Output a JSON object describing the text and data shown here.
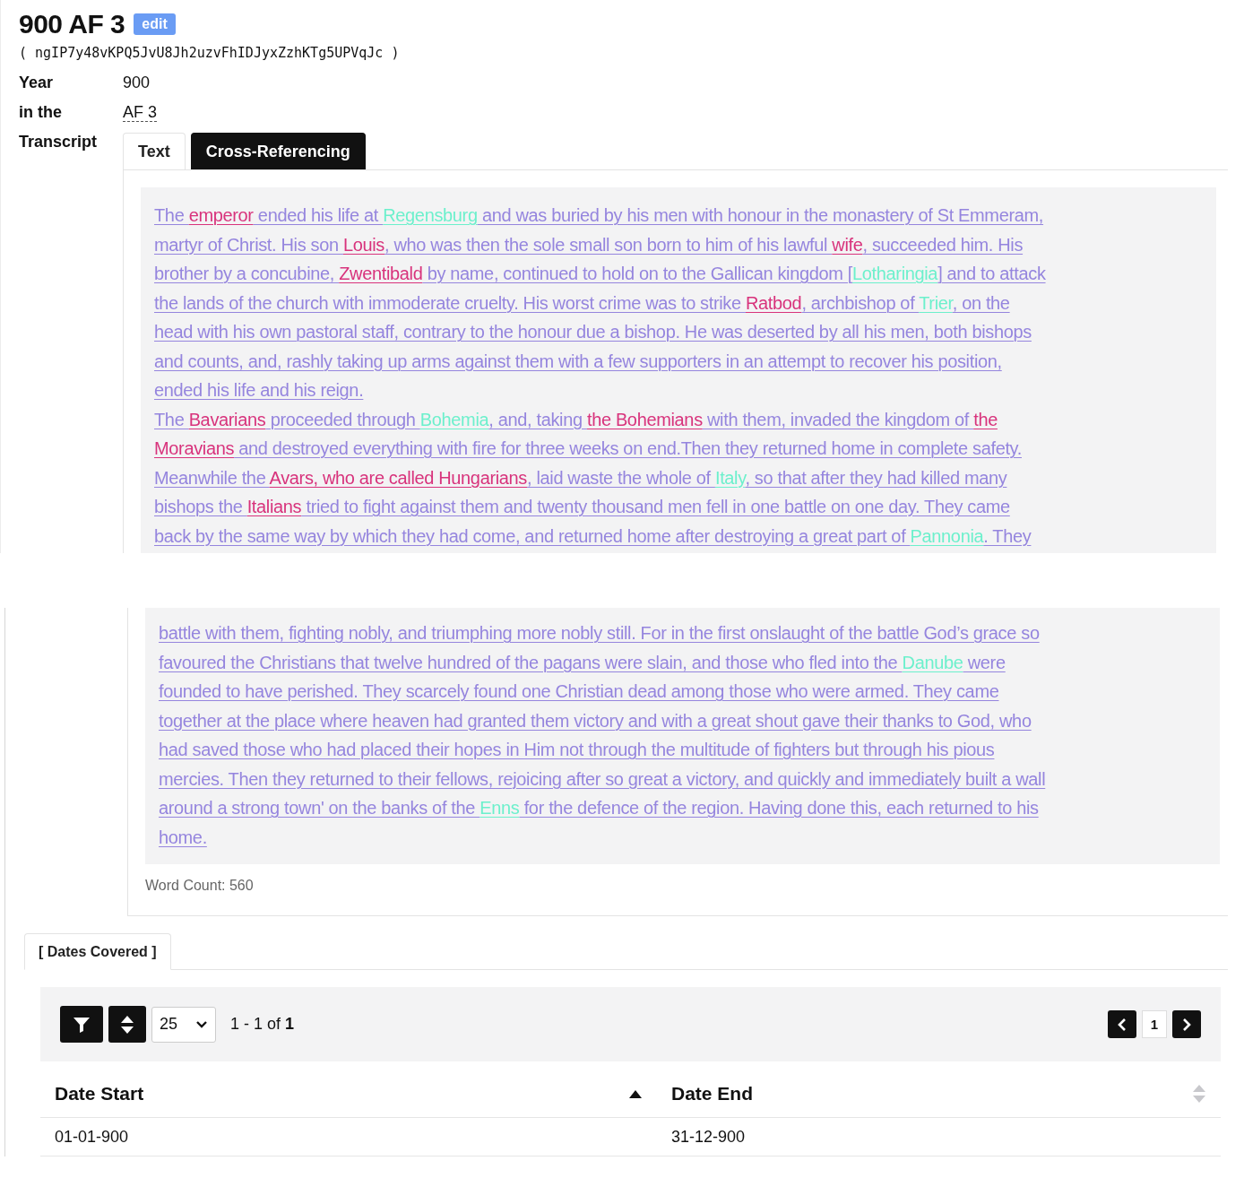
{
  "header": {
    "title": "900 AF 3",
    "edit_label": "edit",
    "id": "( ngIP7y48vKPQ5JvU8Jh2uzvFhIDJyxZzhKTg5UPVqJc )"
  },
  "fields": [
    {
      "label": "Year",
      "value": "900",
      "kind": "text"
    },
    {
      "label": "in the",
      "value": "AF 3",
      "kind": "abbr"
    }
  ],
  "transcript": {
    "label": "Transcript",
    "tabs": [
      {
        "label": "Text",
        "selected": false
      },
      {
        "label": "Cross-Referencing",
        "selected": true
      }
    ],
    "lines_top": [
      [
        {
          "text": "The ",
          "kind": "plain"
        },
        {
          "text": "emperor",
          "kind": "person"
        },
        {
          "text": " ended his life at ",
          "kind": "plain"
        },
        {
          "text": "Regensburg",
          "kind": "place"
        },
        {
          "text": " and was buried by his men with honour in the monastery of St Emmeram,",
          "kind": "plain"
        }
      ],
      [
        {
          "text": "martyr of Christ. His son ",
          "kind": "plain"
        },
        {
          "text": "Louis",
          "kind": "person"
        },
        {
          "text": ", who was then the sole small son born to him of his lawful ",
          "kind": "plain"
        },
        {
          "text": "wife",
          "kind": "person"
        },
        {
          "text": ", succeeded him. His",
          "kind": "plain"
        }
      ],
      [
        {
          "text": "brother by a concubine, ",
          "kind": "plain"
        },
        {
          "text": "Zwentibald",
          "kind": "person"
        },
        {
          "text": " by name, continued to hold on to the Gallican kingdom [",
          "kind": "plain"
        },
        {
          "text": "Lotharingia",
          "kind": "place"
        },
        {
          "text": "] and to attack",
          "kind": "plain"
        }
      ],
      [
        {
          "text": "the lands of the church with immoderate cruelty. His worst crime was to strike ",
          "kind": "plain"
        },
        {
          "text": "Ratbod",
          "kind": "person"
        },
        {
          "text": ", archbishop of ",
          "kind": "plain"
        },
        {
          "text": "Trier",
          "kind": "place"
        },
        {
          "text": ", on the",
          "kind": "plain"
        }
      ],
      [
        {
          "text": "head with his own pastoral staff, contrary to the honour due a bishop. He was deserted by all his men, both bishops",
          "kind": "plain"
        }
      ],
      [
        {
          "text": "and counts, and, rashly taking up arms against them with a few supporters in an attempt to recover his position,",
          "kind": "plain"
        }
      ],
      [
        {
          "text": "ended his life and his reign.",
          "kind": "plain"
        }
      ],
      [
        {
          "text": "The ",
          "kind": "plain"
        },
        {
          "text": "Bavarians",
          "kind": "person"
        },
        {
          "text": " proceeded through ",
          "kind": "plain"
        },
        {
          "text": "Bohemia",
          "kind": "place"
        },
        {
          "text": ", and, taking ",
          "kind": "plain"
        },
        {
          "text": "the Bohemians",
          "kind": "person"
        },
        {
          "text": " with them, invaded the kingdom of ",
          "kind": "plain"
        },
        {
          "text": "the",
          "kind": "person"
        }
      ],
      [
        {
          "text": "Moravians",
          "kind": "person"
        },
        {
          "text": " and destroyed everything with fire for three weeks on end.Then they returned home in complete safety.",
          "kind": "plain"
        }
      ],
      [
        {
          "text": "Meanwhile the ",
          "kind": "plain"
        },
        {
          "text": "Avars, who are called Hungarians",
          "kind": "person"
        },
        {
          "text": ", laid waste the whole of ",
          "kind": "plain"
        },
        {
          "text": "Italy",
          "kind": "place"
        },
        {
          "text": ", so that after they had killed many",
          "kind": "plain"
        }
      ],
      [
        {
          "text": "bishops the ",
          "kind": "plain"
        },
        {
          "text": "Italians",
          "kind": "person"
        },
        {
          "text": " tried to fight against them and twenty thousand men fell in one battle on one day. They came",
          "kind": "plain"
        }
      ],
      [
        {
          "text": "back by the same way by which they had come, and returned home after destroying a great part of ",
          "kind": "plain"
        },
        {
          "text": "Pannonia",
          "kind": "place"
        },
        {
          "text": ". They",
          "kind": "plain"
        }
      ]
    ],
    "lines_bottom": [
      [
        {
          "text": "battle with them, fighting nobly, and triumphing more nobly still. For in the first onslaught of the battle God’s grace so",
          "kind": "plain"
        }
      ],
      [
        {
          "text": "favoured the Christians that twelve hundred of the pagans were slain, and those who fled into the ",
          "kind": "plain"
        },
        {
          "text": "Danube",
          "kind": "place"
        },
        {
          "text": " were",
          "kind": "plain"
        }
      ],
      [
        {
          "text": "founded to have perished. They scarcely found one Christian dead among those who were armed. They came",
          "kind": "plain"
        }
      ],
      [
        {
          "text": "together at the place where heaven had granted them victory and with a great shout gave their thanks to God, who",
          "kind": "plain"
        }
      ],
      [
        {
          "text": "had saved those who had placed their hopes in Him not through the multitude of fighters but through his pious",
          "kind": "plain"
        }
      ],
      [
        {
          "text": "mercies. Then they returned to their fellows, rejoicing after so great a victory, and quickly and immediately built a wall",
          "kind": "plain"
        }
      ],
      [
        {
          "text": "around a strong town' on the banks of the ",
          "kind": "plain"
        },
        {
          "text": "Enns",
          "kind": "place"
        },
        {
          "text": " for the defence of the region. Having done this, each returned to his",
          "kind": "plain"
        }
      ],
      [
        {
          "text": "home.",
          "kind": "plain"
        }
      ]
    ],
    "word_count": "Word Count: 560"
  },
  "dates": {
    "tab": "[ Dates Covered ]",
    "page_size": "25",
    "range": "1 - 1 of **1**",
    "page": "1",
    "columns": [
      {
        "label": "Date Start",
        "selected": true
      },
      {
        "label": "Date End",
        "selected": false
      }
    ],
    "rows": [
      [
        "01-01-900",
        "31-12-900"
      ]
    ]
  }
}
